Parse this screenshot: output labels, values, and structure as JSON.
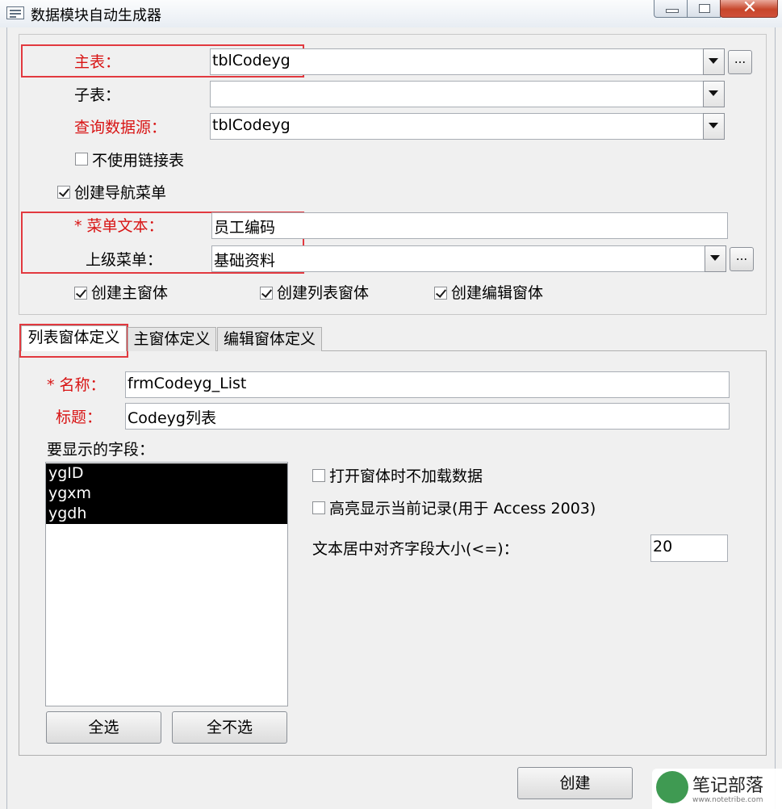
{
  "window": {
    "title": "数据模块自动生成器",
    "close_glyph": "✕"
  },
  "top": {
    "main_table_label": "主表：",
    "main_table_value": "tblCodeyg",
    "sub_table_label": "子表：",
    "sub_table_value": "",
    "query_source_label": "查询数据源：",
    "query_source_value": "tblCodeyg",
    "no_link_table_label": "不使用链接表",
    "no_link_table_checked": false,
    "create_nav_menu_label": "创建导航菜单",
    "create_nav_menu_checked": true,
    "menu_text_label": "* 菜单文本：",
    "menu_text_value": "员工编码",
    "parent_menu_label": "上级菜单：",
    "parent_menu_value": "基础资料",
    "ellipsis": "...",
    "create_main_form_label": "创建主窗体",
    "create_list_form_label": "创建列表窗体",
    "create_edit_form_label": "创建编辑窗体"
  },
  "tabs": [
    {
      "label": "列表窗体定义",
      "active": true
    },
    {
      "label": "主窗体定义",
      "active": false
    },
    {
      "label": "编辑窗体定义",
      "active": false
    }
  ],
  "list_tab": {
    "name_label": "* 名称：",
    "name_value": "frmCodeyg_List",
    "caption_label": "标题：",
    "caption_value": "Codeyg列表",
    "fields_label": "要显示的字段：",
    "fields": [
      "ygID",
      "ygxm",
      "ygdh"
    ],
    "select_all_label": "全选",
    "select_none_label": "全不选",
    "no_load_data_label": "打开窗体时不加载数据",
    "highlight_record_label": "高亮显示当前记录(用于 Access 2003)",
    "center_align_label": "文本居中对齐字段大小(<=)：",
    "center_align_value": "20"
  },
  "footer": {
    "create_label": "创建"
  },
  "watermark": {
    "text": "笔记部落",
    "sub": "www.notetribe.com"
  },
  "colors": {
    "required_red": "#d81414",
    "highlight_red": "#e2393f",
    "selection": "#000000"
  }
}
